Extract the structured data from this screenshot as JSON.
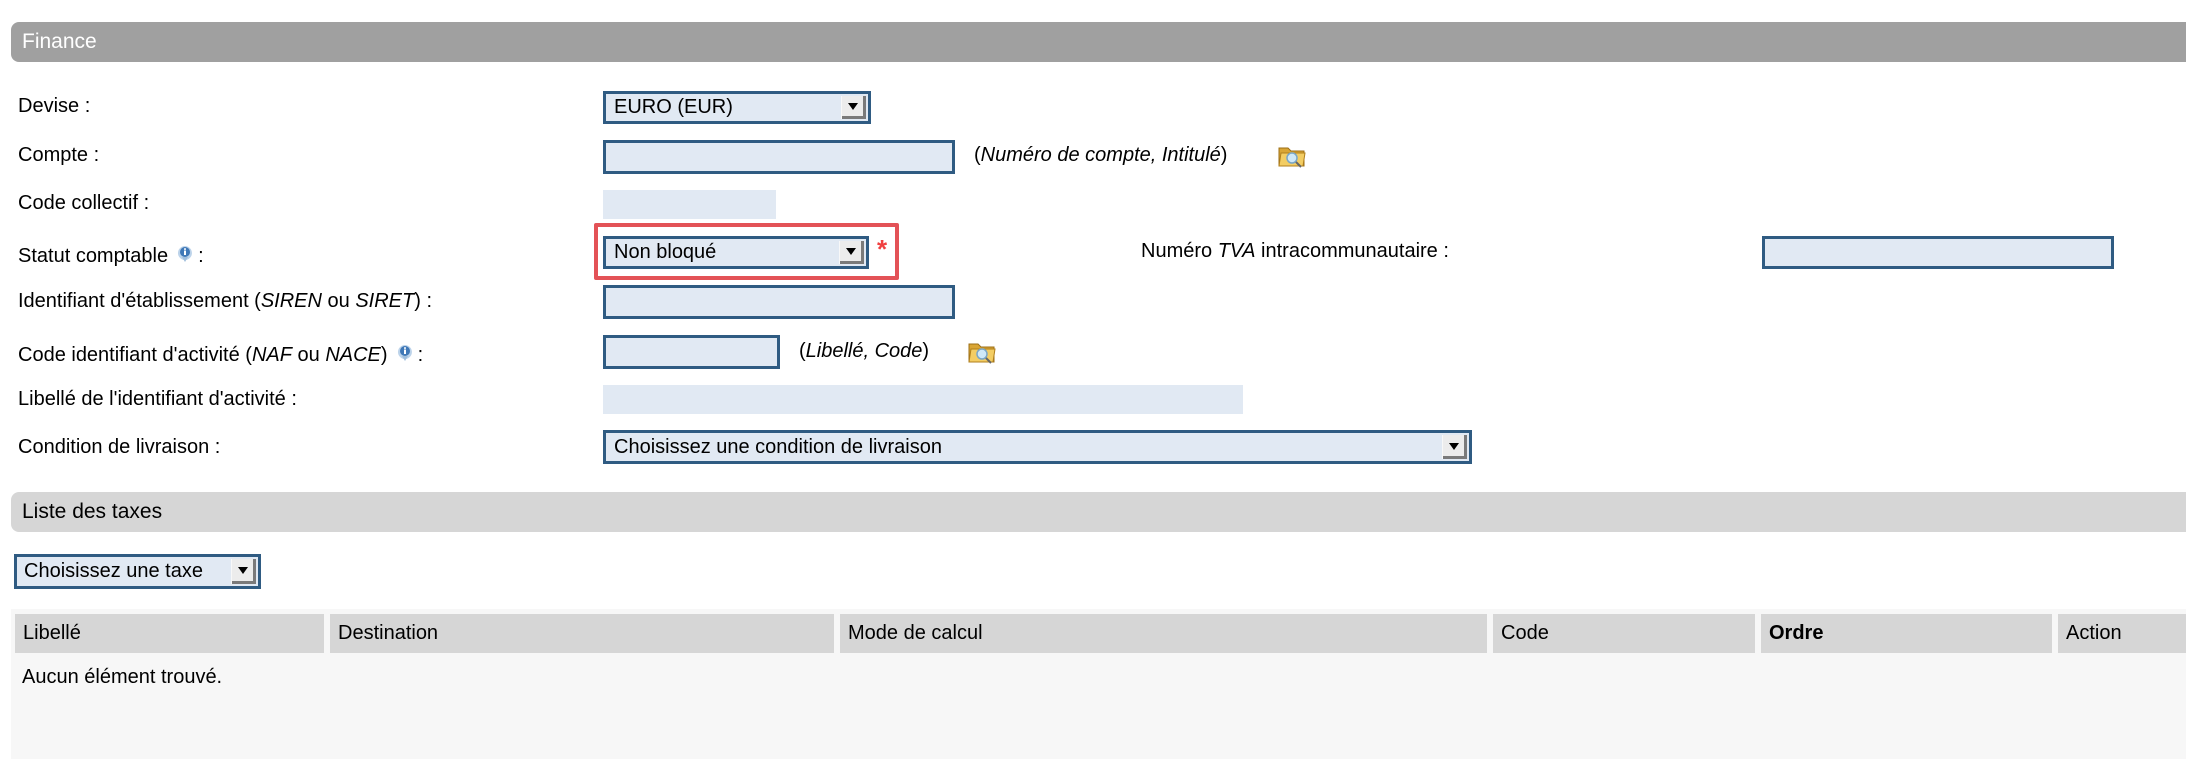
{
  "sections": {
    "finance": "Finance",
    "taxes": "Liste des taxes"
  },
  "form": {
    "devise": {
      "label": "Devise :",
      "value": "EURO (EUR)"
    },
    "compte": {
      "label": "Compte :",
      "value": "",
      "hint_open": "(",
      "hint_italic": "Numéro de compte, Intitulé",
      "hint_close": ")",
      "lookup_icon": "folder-search-icon"
    },
    "code_collectif": {
      "label": "Code collectif :",
      "value": ""
    },
    "statut_comptable": {
      "label": "Statut comptable",
      "label_suffix": ":",
      "value": "Non bloqué",
      "required_marker": "*",
      "info_icon": "info-icon"
    },
    "tva": {
      "label_pre": "Numéro ",
      "label_italic": "TVA",
      "label_post": " intracommunautaire :",
      "value": ""
    },
    "identifiant": {
      "label_pre": "Identifiant d'établissement (",
      "label_it1": "SIREN",
      "label_mid": " ou ",
      "label_it2": "SIRET",
      "label_post": ") :",
      "value": ""
    },
    "code_activite": {
      "label_pre": "Code identifiant d'activité (",
      "label_it1": "NAF",
      "label_mid": " ou ",
      "label_it2": "NACE",
      "label_post": ")",
      "label_suffix": ":",
      "value": "",
      "hint_open": "(",
      "hint_italic": "Libellé, Code",
      "hint_close": ")",
      "info_icon": "info-icon",
      "lookup_icon": "folder-search-icon"
    },
    "libelle_activite": {
      "label": "Libellé de l'identifiant d'activité :",
      "value": ""
    },
    "condition_livraison": {
      "label": "Condition de livraison :",
      "value": "Choisissez une condition de livraison"
    }
  },
  "taxes": {
    "select_value": "Choisissez une taxe",
    "columns": [
      "Libellé",
      "Destination",
      "Mode de calcul",
      "Code",
      "Ordre",
      "Action"
    ],
    "sorted_column": "Ordre",
    "rows": [],
    "empty_message": "Aucun élément trouvé."
  },
  "colors": {
    "finance_bar": "#a0a0a0",
    "taxes_bar": "#d6d6d6",
    "input_bg": "#e1e9f3",
    "input_border": "#2f5b82",
    "highlight": "#e35257",
    "required": "#f04040"
  }
}
